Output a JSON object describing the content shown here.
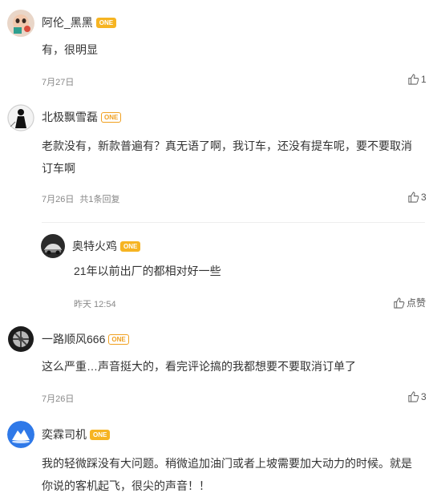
{
  "comments": [
    {
      "username": "阿伦_黑黑",
      "badge": "ONE",
      "content": "有，很明显",
      "date": "7月27日",
      "likes": "1"
    },
    {
      "username": "北极飘雪磊",
      "badge": "ONE",
      "content_line1": "老款没有，新款普遍有？真无语了啊，我订车，还没有提车呢，要不要取消",
      "content_line2": "订车啊",
      "date": "7月26日",
      "reply_count": "共1条回复",
      "likes": "3",
      "reply": {
        "username": "奥特火鸡",
        "badge": "ONE",
        "content": "21年以前出厂的都相对好一些",
        "date": "昨天 12:54",
        "like_label": "点赞"
      }
    },
    {
      "username": "一路顺风666",
      "badge": "ONE",
      "content": "这么严重…声音挺大的，看完评论搞的我都想要不要取消订单了",
      "date": "7月26日",
      "likes": "3"
    },
    {
      "username": "奕霖司机",
      "badge": "ONE",
      "content_line1": "我的轻微踩没有大问题。稍微追加油门或者上坡需要加大动力的时候。就是",
      "content_line2": "你说的客机起飞，很尖的声音！！"
    }
  ],
  "icons": {
    "like": "thumbs-up-icon",
    "avatar1": "child-photo-avatar",
    "avatar2": "silhouette-avatar",
    "avatar3": "car-avatar",
    "avatar4": "wheel-avatar",
    "avatar5": "mountain-avatar"
  },
  "colors": {
    "badge": "#f6b422",
    "meta": "#888888",
    "avatar5_bg": "#2f79e8"
  }
}
